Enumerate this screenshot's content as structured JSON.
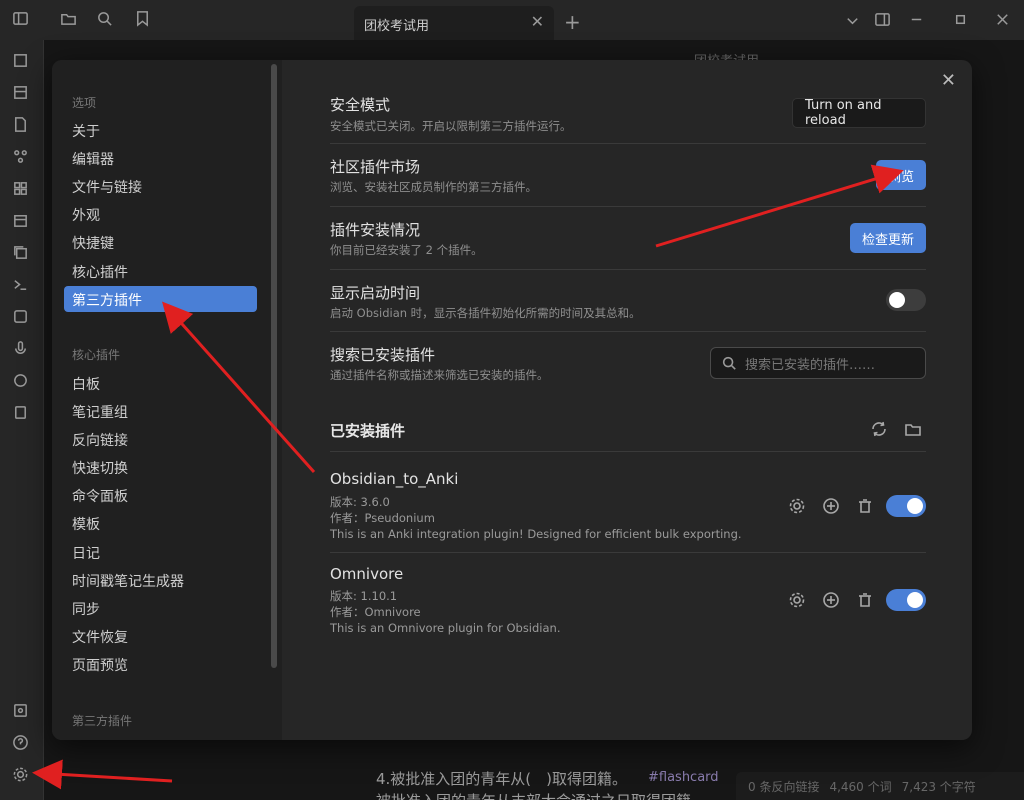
{
  "tab": {
    "title": "团校考试用",
    "close": "✕",
    "new": "+"
  },
  "editor": {
    "title": "团校考试用",
    "line1": "4.被批准入团的青年从(　)取得团籍。",
    "tag": "#flashcard",
    "line2": "被批准入团的青年从支部大会通过之日取得团籍"
  },
  "statusbar": {
    "backlinks": "0 条反向链接",
    "words": "4,460 个词",
    "chars": "7,423 个字符"
  },
  "sidebar": {
    "groups": [
      "选项",
      "核心插件",
      "第三方插件"
    ],
    "options": [
      "关于",
      "编辑器",
      "文件与链接",
      "外观",
      "快捷键",
      "核心插件",
      "第三方插件"
    ],
    "core": [
      "白板",
      "笔记重组",
      "反向链接",
      "快速切换",
      "命令面板",
      "模板",
      "日记",
      "时间戳笔记生成器",
      "同步",
      "文件恢复",
      "页面预览"
    ]
  },
  "settings": {
    "safe_mode": {
      "title": "安全模式",
      "desc": "安全模式已关闭。开启以限制第三方插件运行。",
      "button": "Turn on and reload"
    },
    "community": {
      "title": "社区插件市场",
      "desc": "浏览、安装社区成员制作的第三方插件。",
      "button": "浏览"
    },
    "install": {
      "title": "插件安装情况",
      "desc": "你目前已经安装了 2 个插件。",
      "button": "检查更新"
    },
    "startup": {
      "title": "显示启动时间",
      "desc": "启动 Obsidian 时，显示各插件初始化所需的时间及其总和。",
      "toggle": false
    },
    "search": {
      "title": "搜索已安装插件",
      "desc": "通过插件名称或描述来筛选已安装的插件。",
      "placeholder": "搜索已安装的插件……"
    }
  },
  "installed": {
    "heading": "已安装插件",
    "plugins": [
      {
        "name": "Obsidian_to_Anki",
        "version": "版本: 3.6.0",
        "author": "作者：Pseudonium",
        "desc": "This is an Anki integration plugin! Designed for efficient bulk exporting.",
        "enabled": true
      },
      {
        "name": "Omnivore",
        "version": "版本: 1.10.1",
        "author": "作者：Omnivore",
        "desc": "This is an Omnivore plugin for Obsidian.",
        "enabled": true
      }
    ]
  },
  "colors": {
    "accent": "#4a7fd6",
    "annotation": "#e02020"
  }
}
